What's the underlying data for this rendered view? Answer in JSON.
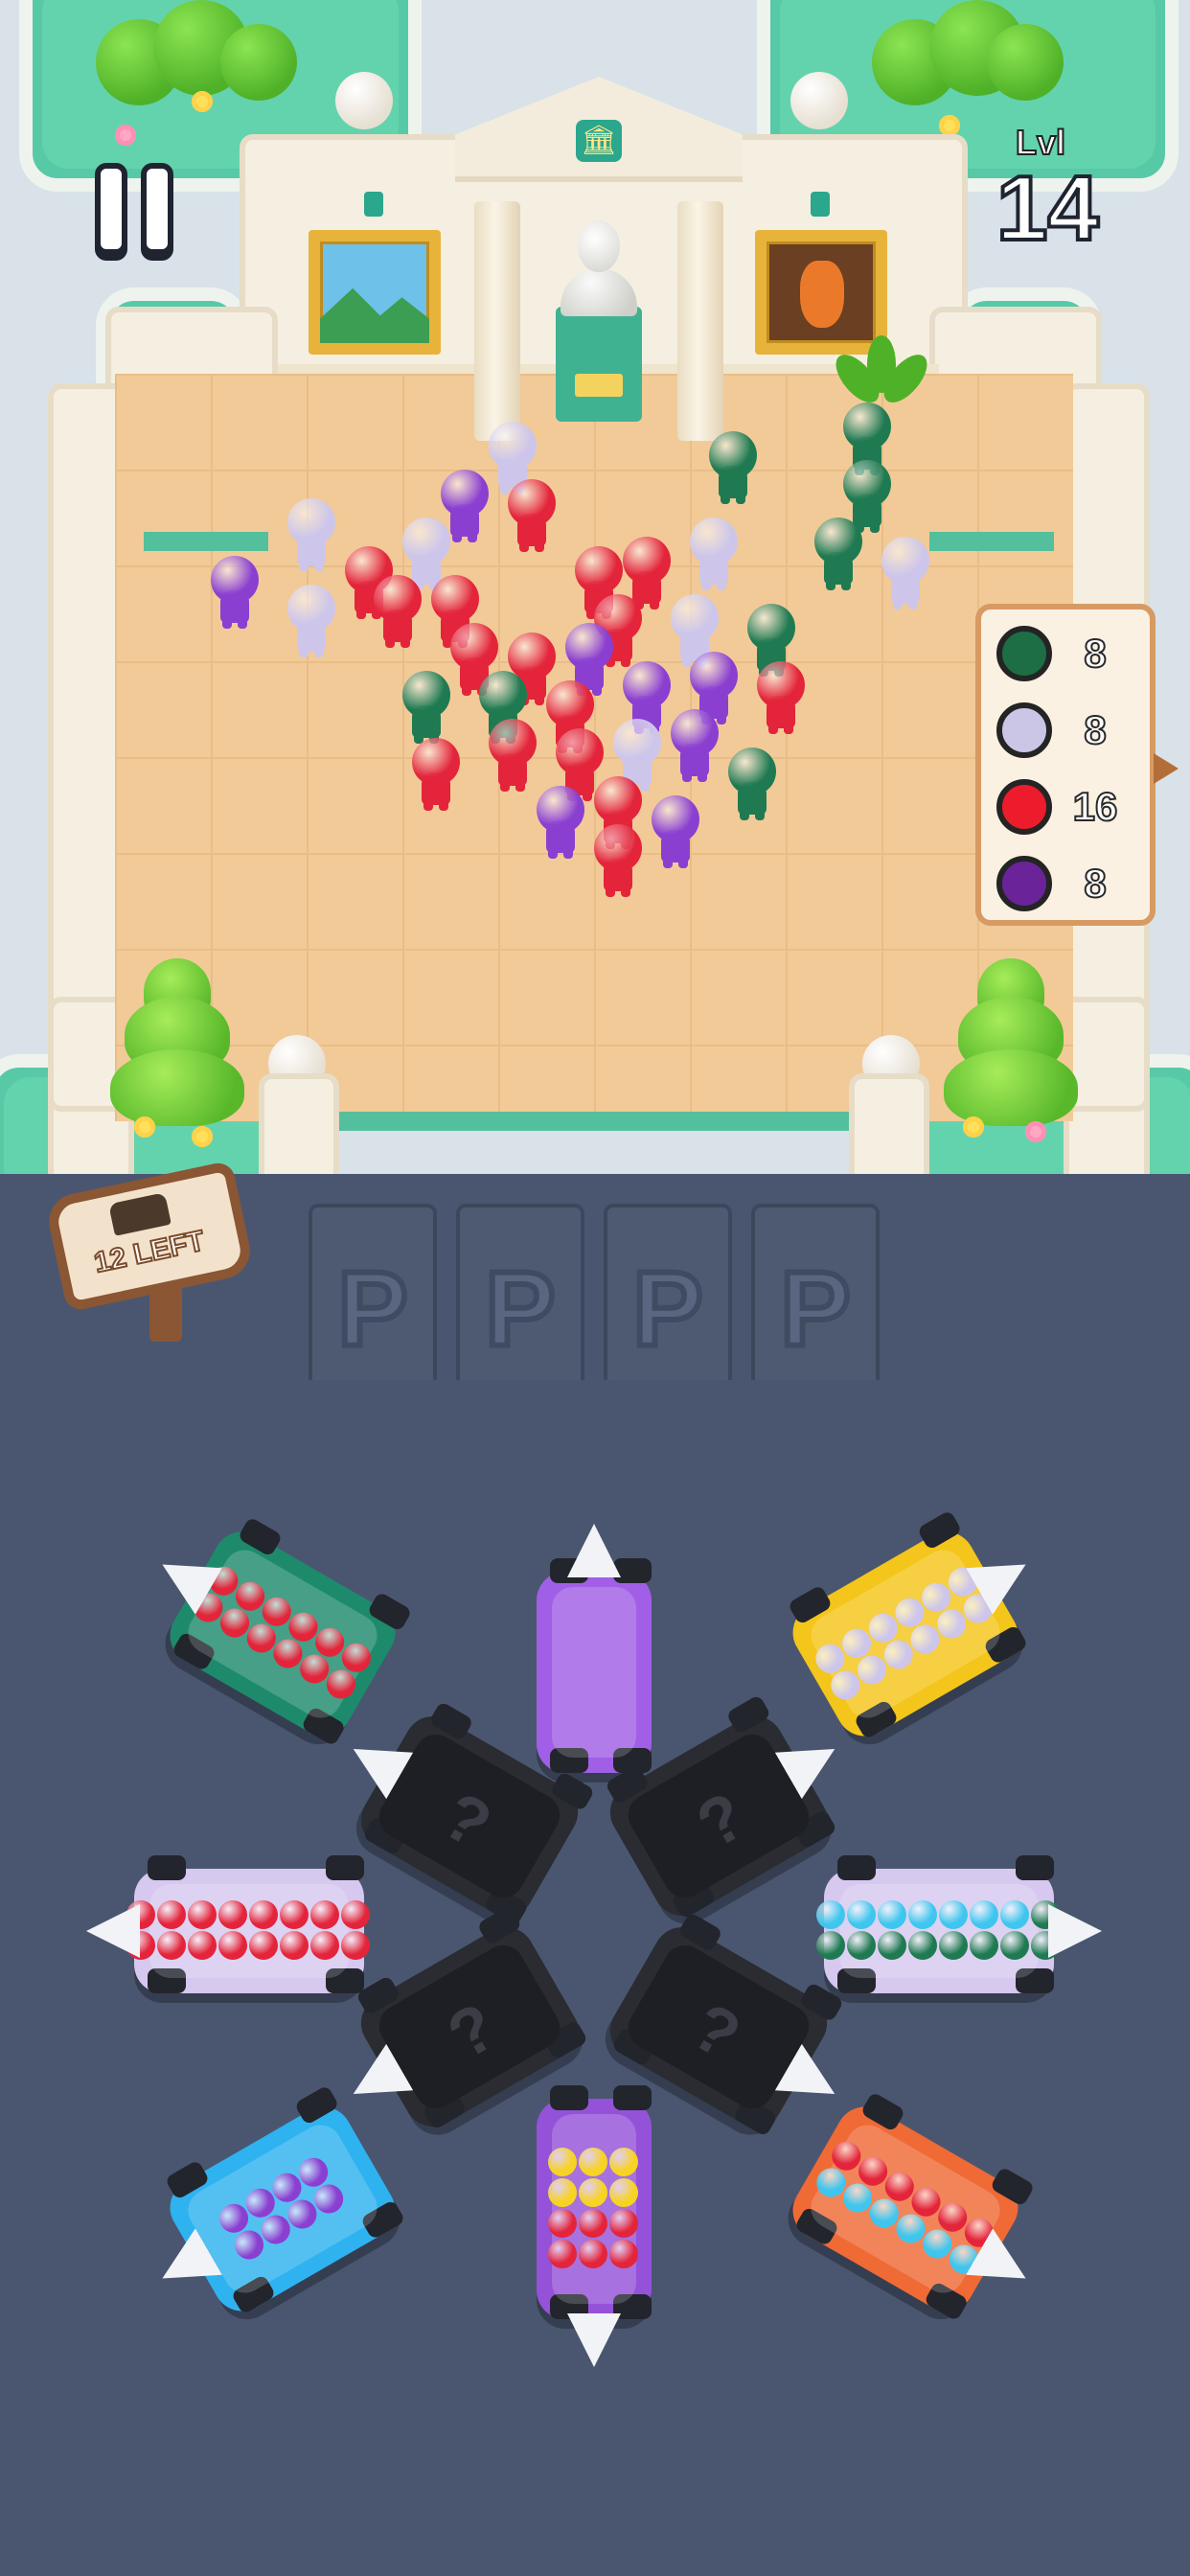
{
  "hud": {
    "level_label": "Lvl",
    "level_number": "14",
    "pause_icon": "pause-icon"
  },
  "crowd_counts": [
    {
      "color_name": "green",
      "color": "#1d6d45",
      "count": "8"
    },
    {
      "color_name": "lavender",
      "color": "#cbc6e6",
      "count": "8"
    },
    {
      "color_name": "red",
      "color": "#ec1c2c",
      "count": "16"
    },
    {
      "color_name": "purple",
      "color": "#6a2399",
      "count": "8"
    }
  ],
  "bus_sign": {
    "label": "12 LEFT",
    "icon": "bus-icon"
  },
  "parking_slots": [
    "P",
    "P",
    "P",
    "P"
  ],
  "vehicles": [
    {
      "name": "green-bus",
      "body": "#1e8a6c",
      "cargo": [
        "red",
        "red",
        "red",
        "red",
        "red",
        "red",
        "red",
        "red",
        "red",
        "red",
        "red",
        "red"
      ]
    },
    {
      "name": "purple-van-top",
      "body": "#a05fe6",
      "cargo": []
    },
    {
      "name": "yellow-bus",
      "body": "#f4c51a",
      "cargo": [
        "lavender",
        "lavender",
        "lavender",
        "lavender",
        "lavender",
        "lavender",
        "lavender",
        "lavender",
        "lavender",
        "lavender",
        "lavender",
        "lavender"
      ]
    },
    {
      "name": "lavender-bus-left",
      "body": "#d6c8ef",
      "cargo": [
        "red",
        "red",
        "red",
        "red",
        "red",
        "red",
        "red",
        "red",
        "red",
        "red",
        "red",
        "red",
        "red",
        "red",
        "red",
        "red"
      ]
    },
    {
      "name": "lavender-bus-right",
      "body": "#d6c8ef",
      "cargo": [
        "blue",
        "blue",
        "blue",
        "blue",
        "blue",
        "blue",
        "blue",
        "green",
        "green",
        "green",
        "green",
        "green",
        "green",
        "green",
        "green",
        "green"
      ]
    },
    {
      "name": "blue-bus",
      "body": "#2fb2f0",
      "cargo": [
        "purple",
        "purple",
        "purple",
        "purple",
        "purple",
        "purple",
        "purple",
        "purple"
      ]
    },
    {
      "name": "purple-van-bottom",
      "body": "#9452d8",
      "cargo": [
        "yellow",
        "yellow",
        "yellow",
        "yellow",
        "yellow",
        "yellow",
        "red",
        "red",
        "red",
        "red",
        "red",
        "red"
      ]
    },
    {
      "name": "orange-bus",
      "body": "#f06a36",
      "cargo": [
        "red",
        "red",
        "red",
        "red",
        "red",
        "red",
        "blue",
        "blue",
        "blue",
        "blue",
        "blue",
        "blue"
      ]
    },
    {
      "name": "mystery-car-1",
      "body": "#2a2c31",
      "cargo": []
    },
    {
      "name": "mystery-car-2",
      "body": "#2a2c31",
      "cargo": []
    },
    {
      "name": "mystery-car-3",
      "body": "#2a2c31",
      "cargo": []
    },
    {
      "name": "mystery-car-4",
      "body": "#2a2c31",
      "cargo": []
    }
  ],
  "palette": {
    "red": "#e3243a",
    "green": "#1f7a52",
    "lavender": "#cdc6ea",
    "purple": "#8a3fd0",
    "blue": "#3ec6ee",
    "yellow": "#f7d322"
  }
}
